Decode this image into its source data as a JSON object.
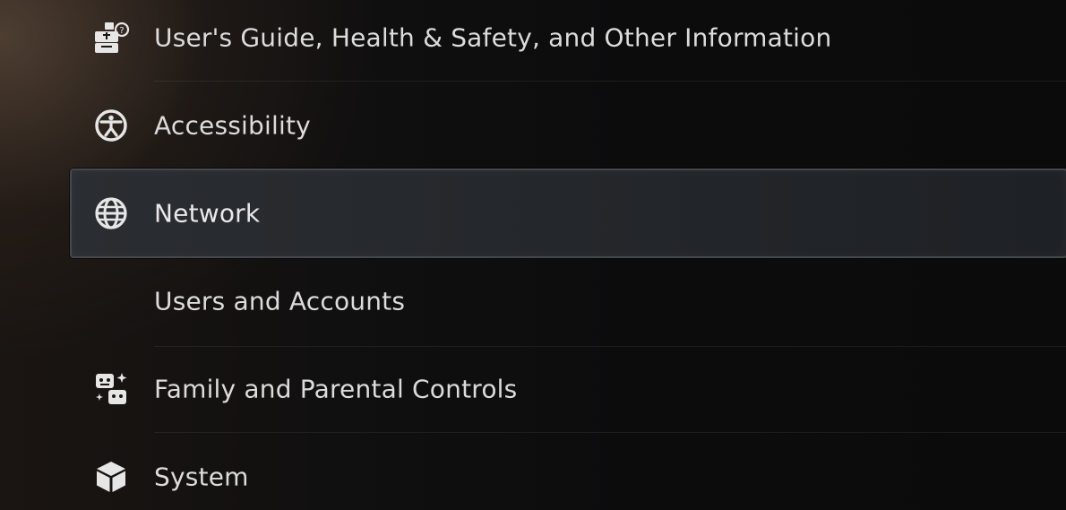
{
  "settings_menu": {
    "items": [
      {
        "label": "User's Guide, Health & Safety, and Other Information",
        "icon": "guide-icon",
        "selected": false
      },
      {
        "label": "Accessibility",
        "icon": "accessibility-icon",
        "selected": false
      },
      {
        "label": "Network",
        "icon": "globe-icon",
        "selected": true
      },
      {
        "label": "Users and Accounts",
        "icon": "",
        "selected": false
      },
      {
        "label": "Family and Parental Controls",
        "icon": "family-controls-icon",
        "selected": false
      },
      {
        "label": "System",
        "icon": "cube-icon",
        "selected": false
      }
    ]
  }
}
